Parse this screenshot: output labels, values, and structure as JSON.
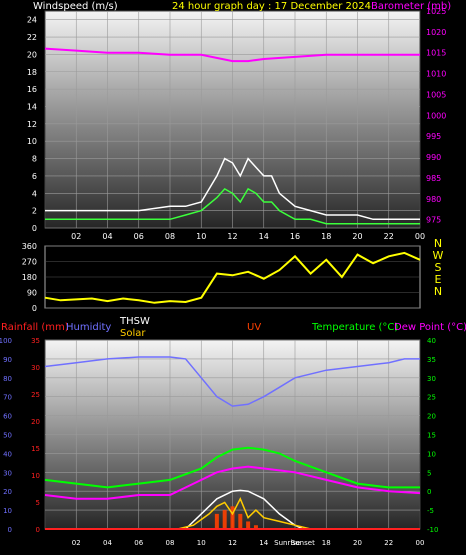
{
  "colors": {
    "wind": "#ffffff",
    "gust": "#3cff3c",
    "barometer": "#ff00ff",
    "direction": "#ffff00",
    "rainfall": "#ff2020",
    "humidity": "#7070ff",
    "thsw": "#ffffff",
    "solar": "#ffcc00",
    "uv": "#ff4000",
    "temperature": "#00ff00",
    "dew": "#ff00ff"
  },
  "chart_data": [
    {
      "type": "line",
      "title": "24 hour graph day : 17 December 2024",
      "left_label": "Windspeed (m/s)",
      "right_label": "Barometer (mb)",
      "x_ticks": [
        "02",
        "04",
        "06",
        "08",
        "10",
        "12",
        "14",
        "16",
        "18",
        "20",
        "22",
        "00"
      ],
      "y_left_ticks": [
        0,
        2,
        4,
        6,
        8,
        10,
        12,
        14,
        16,
        18,
        20,
        22,
        24
      ],
      "y_right_ticks": [
        975,
        980,
        985,
        990,
        995,
        1000,
        1005,
        1010,
        1015,
        1020,
        1025
      ],
      "ylim_left": [
        0,
        25
      ],
      "ylim_right": [
        973,
        1025
      ],
      "series": [
        {
          "key": "wind_gust",
          "hours": [
            0,
            2,
            4,
            6,
            8,
            9,
            10,
            11,
            11.5,
            12,
            12.5,
            13,
            13.5,
            14,
            14.5,
            15,
            16,
            17,
            18,
            19,
            20,
            21,
            22,
            23,
            24
          ],
          "values": [
            2,
            2,
            2,
            2,
            2.5,
            2.5,
            3,
            6,
            8,
            7.5,
            6,
            8,
            7,
            6,
            6,
            4,
            2.5,
            2,
            1.5,
            1.5,
            1.5,
            1,
            1,
            1,
            1
          ]
        },
        {
          "key": "wind_avg",
          "hours": [
            0,
            2,
            4,
            6,
            8,
            9,
            10,
            11,
            11.5,
            12,
            12.5,
            13,
            13.5,
            14,
            14.5,
            15,
            16,
            17,
            18,
            19,
            20,
            21,
            22,
            23,
            24
          ],
          "values": [
            1,
            1,
            1,
            1,
            1,
            1.5,
            2,
            3.5,
            4.5,
            4,
            3,
            4.5,
            4,
            3,
            3,
            2,
            1,
            1,
            0.5,
            0.5,
            0.5,
            0.5,
            0.5,
            0.5,
            0.5
          ]
        },
        {
          "key": "barometer",
          "hours": [
            0,
            2,
            4,
            6,
            8,
            10,
            12,
            13,
            14,
            16,
            18,
            20,
            22,
            24
          ],
          "values": [
            1016,
            1015.5,
            1015,
            1015,
            1014.5,
            1014.5,
            1013,
            1013,
            1013.5,
            1014,
            1014.5,
            1014.5,
            1014.5,
            1014.5
          ]
        }
      ]
    },
    {
      "type": "scatter",
      "title": "Wind direction",
      "y_ticks": [
        0,
        90,
        180,
        270,
        360
      ],
      "compass": [
        "N",
        "W",
        "S",
        "E",
        "N"
      ],
      "ylim": [
        0,
        360
      ],
      "series": [
        {
          "key": "direction",
          "hours": [
            0,
            1,
            2,
            3,
            4,
            5,
            6,
            7,
            8,
            9,
            10,
            11,
            12,
            13,
            14,
            15,
            16,
            17,
            18,
            19,
            20,
            21,
            22,
            23,
            24
          ],
          "values": [
            60,
            45,
            50,
            55,
            40,
            55,
            45,
            30,
            40,
            35,
            60,
            200,
            190,
            210,
            170,
            220,
            300,
            200,
            280,
            180,
            310,
            260,
            300,
            320,
            280
          ]
        }
      ]
    },
    {
      "type": "line",
      "left_labels": [
        "Rainfall (mm)",
        "Humidity",
        "THSW",
        "Solar",
        "UV"
      ],
      "right_labels": [
        "Temperature (°C)",
        "Dew Point (°C)"
      ],
      "x_ticks": [
        "02",
        "04",
        "06",
        "08",
        "10",
        "12",
        "14",
        "Sunrise",
        "Sunset",
        "18",
        "20",
        "22",
        "00"
      ],
      "rain_ticks": [
        0,
        5,
        10,
        15,
        20,
        25,
        30,
        35
      ],
      "humidity_ticks": [
        0,
        10,
        20,
        30,
        40,
        50,
        60,
        70,
        80,
        90,
        100
      ],
      "temp_ticks": [
        -10,
        -5,
        0,
        5,
        10,
        15,
        20,
        25,
        30,
        35,
        40
      ],
      "ylim_temp": [
        -10,
        40
      ],
      "series": [
        {
          "key": "humidity",
          "hours": [
            0,
            2,
            4,
            6,
            8,
            9,
            10,
            11,
            12,
            13,
            14,
            15,
            16,
            18,
            20,
            22,
            23,
            24
          ],
          "values": [
            86,
            88,
            90,
            91,
            91,
            90,
            80,
            70,
            65,
            66,
            70,
            75,
            80,
            84,
            86,
            88,
            90,
            90
          ]
        },
        {
          "key": "temperature",
          "hours": [
            0,
            2,
            4,
            6,
            8,
            10,
            11,
            12,
            13,
            14,
            15,
            16,
            18,
            20,
            22,
            24
          ],
          "values": [
            3,
            2,
            1,
            2,
            3,
            6,
            9,
            11,
            11.5,
            11,
            10,
            8,
            5,
            2,
            1,
            1
          ]
        },
        {
          "key": "dew_point",
          "hours": [
            0,
            2,
            4,
            6,
            8,
            10,
            11,
            12,
            13,
            14,
            15,
            16,
            18,
            20,
            22,
            24
          ],
          "values": [
            -1,
            -2,
            -2,
            -1,
            -1,
            3,
            5,
            6,
            6.5,
            6,
            5.5,
            5,
            3,
            1,
            0,
            -0.5
          ]
        },
        {
          "key": "solar",
          "hours": [
            7.5,
            8.5,
            9.5,
            10.5,
            11,
            11.5,
            12,
            12.5,
            13,
            13.5,
            14,
            15,
            16,
            17
          ],
          "values": [
            -10,
            -10,
            -9,
            -6,
            -4,
            -3,
            -6,
            -2,
            -7,
            -5,
            -7,
            -8,
            -9,
            -10
          ]
        },
        {
          "key": "thsw_curve",
          "hours": [
            9,
            10,
            11,
            12,
            12.5,
            13,
            14,
            15,
            16,
            16.5
          ],
          "values": [
            -10,
            -6,
            -2,
            0,
            0.2,
            0,
            -2,
            -6,
            -9,
            -10
          ]
        },
        {
          "key": "uv",
          "hours": [
            10.5,
            11,
            11.5,
            12,
            12.5,
            13,
            13.5
          ],
          "values": [
            -10,
            -6,
            -5,
            -4,
            -6,
            -8,
            -9
          ]
        },
        {
          "key": "rain",
          "hours": [
            0,
            24
          ],
          "values": [
            0,
            0
          ]
        }
      ]
    }
  ]
}
